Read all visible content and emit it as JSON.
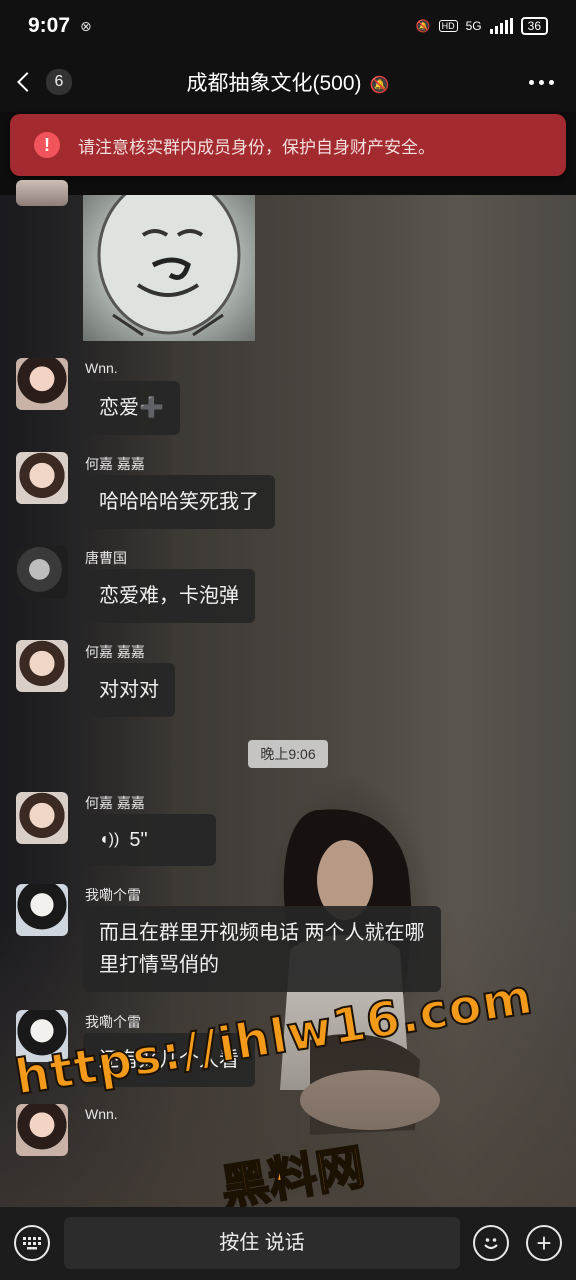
{
  "status_bar": {
    "time": "9:07",
    "network": "5G",
    "hd_badge": "HD",
    "battery": "36"
  },
  "header": {
    "back_count": "6",
    "title": "成都抽象文化(500)"
  },
  "warning": {
    "icon": "!",
    "text": "请注意核实群内成员身份，保护自身财产安全。"
  },
  "messages": [
    {
      "sender": "Wnn.",
      "text": "恋爱➕"
    },
    {
      "sender": "何嘉 嘉嘉",
      "text": "哈哈哈哈笑死我了"
    },
    {
      "sender": "唐曹国",
      "text": "恋爱难，卡泡弹"
    },
    {
      "sender": "何嘉 嘉嘉",
      "text": "对对对"
    },
    {
      "sender": "何嘉 嘉嘉",
      "voice_duration": "5\""
    },
    {
      "sender": "我嘞个雷",
      "text_line1": "而且在群里开视频电话 两个人就在哪",
      "text_line2": "里打情骂俏的"
    },
    {
      "sender": "我嘞个雷",
      "text": "还有好几个人看"
    },
    {
      "sender": "Wnn."
    }
  ],
  "time_divider": "晚上9:06",
  "watermark": {
    "url": "https://ihlw16.com",
    "name": "黑料网"
  },
  "input_bar": {
    "voice_label": "按住 说话"
  },
  "colors": {
    "warning_bg": "#a32a2e",
    "watermark": "#f49a1a"
  }
}
